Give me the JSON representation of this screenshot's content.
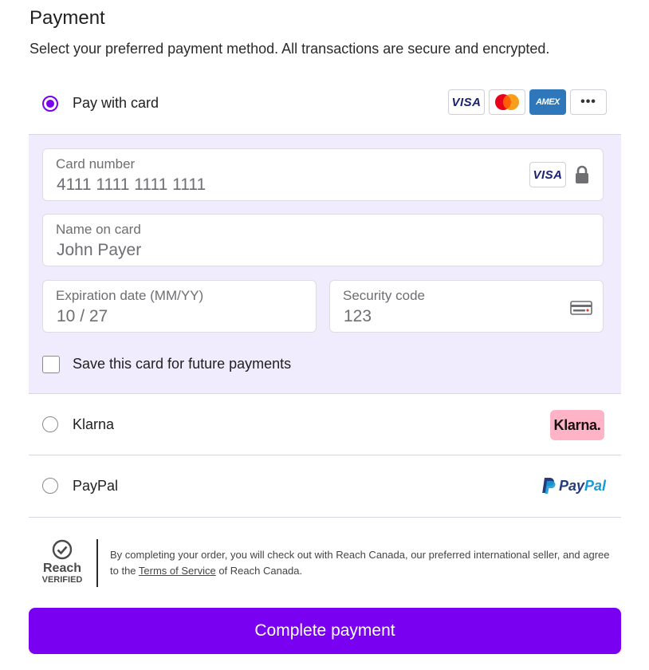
{
  "header": {
    "title": "Payment",
    "subtitle": "Select your preferred payment method. All transactions are secure and encrypted."
  },
  "methods": {
    "card": {
      "label": "Pay with card",
      "selected": true,
      "logos": [
        "VISA",
        "mastercard",
        "AMEX",
        "•••"
      ]
    },
    "klarna": {
      "label": "Klarna",
      "selected": false,
      "logo_text": "Klarna."
    },
    "paypal": {
      "label": "PayPal",
      "selected": false,
      "logo_text_1": "Pay",
      "logo_text_2": "Pal"
    }
  },
  "card_form": {
    "card_number": {
      "label": "Card number",
      "value": "4111 1111 1111 1111",
      "brand": "VISA"
    },
    "name": {
      "label": "Name on card",
      "value": "John Payer"
    },
    "expiration": {
      "label": "Expiration date (MM/YY)",
      "value": "10 / 27"
    },
    "security": {
      "label": "Security code",
      "value": "123"
    },
    "save_card": {
      "label": "Save this card for future payments",
      "checked": false
    }
  },
  "footer": {
    "badge_word": "Reach",
    "badge_sub": "VERIFIED",
    "legal_prefix": "By completing your order, you will check out with Reach Canada, our preferred international seller, and agree to the ",
    "legal_link": "Terms of Service",
    "legal_suffix": " of Reach Canada."
  },
  "cta": {
    "label": "Complete payment"
  },
  "colors": {
    "accent": "#7a00f2",
    "panel_bg": "#f0ecfd",
    "klarna_pink": "#ffb3c7"
  }
}
